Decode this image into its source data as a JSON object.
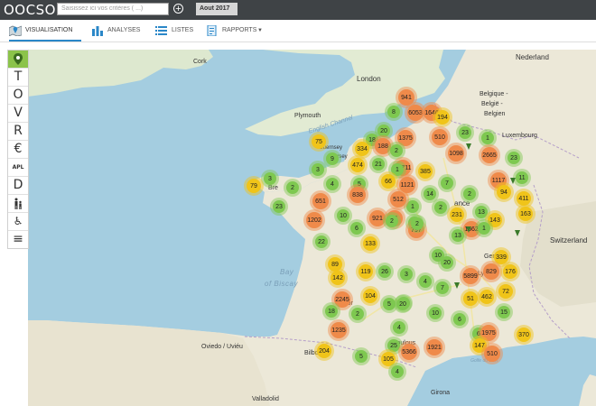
{
  "app": {
    "logo": "OOCSO"
  },
  "search": {
    "placeholder": "Saisissez ici vos critères ( ...)"
  },
  "date_chip": "Aout 2017",
  "nav": {
    "tabs": [
      {
        "label": "VISUALISATION",
        "icon": "map-icon"
      },
      {
        "label": "ANALYSES",
        "icon": "bar-chart-icon"
      },
      {
        "label": "LISTES",
        "icon": "list-icon"
      },
      {
        "label": "RAPPORTS",
        "icon": "report-icon"
      }
    ]
  },
  "toolbar": {
    "items": [
      "T",
      "O",
      "V",
      "R",
      "€",
      "APL",
      "D",
      "",
      "",
      ""
    ]
  },
  "map": {
    "labels": [
      {
        "name": "cork",
        "text": "Cork"
      },
      {
        "name": "london",
        "text": "London"
      },
      {
        "name": "plymouth",
        "text": "Plymouth"
      },
      {
        "name": "english-channel",
        "text": "English Channel"
      },
      {
        "name": "guernsey",
        "text": "Guernsey"
      },
      {
        "name": "jersey",
        "text": "Jersey"
      },
      {
        "name": "nederland",
        "text": "Nederland"
      },
      {
        "name": "belgique",
        "text": "Belgique -"
      },
      {
        "name": "belgie",
        "text": "België -"
      },
      {
        "name": "belgien",
        "text": "Belgien"
      },
      {
        "name": "luxembourg",
        "text": "Luxembourg"
      },
      {
        "name": "ance",
        "text": "ance"
      },
      {
        "name": "switzerland",
        "text": "Switzerland"
      },
      {
        "name": "bay",
        "text": "Bay"
      },
      {
        "name": "of-biscay",
        "text": "of Biscay"
      },
      {
        "name": "bordeaux",
        "text": "Bor"
      },
      {
        "name": "geneve",
        "text": "Genève"
      },
      {
        "name": "lyon",
        "text": "Lyo"
      },
      {
        "name": "toulouse",
        "text": "Toulous"
      },
      {
        "name": "oviedo",
        "text": "Oviedo / Uviéu"
      },
      {
        "name": "bilbo",
        "text": "Bilbo"
      },
      {
        "name": "valladolid",
        "text": "Valladolid"
      },
      {
        "name": "girona",
        "text": "Girona"
      },
      {
        "name": "golfe-du-lion",
        "text": "Golfe du Lion"
      },
      {
        "name": "brest",
        "text": "Bre"
      }
    ],
    "clusters": [
      {
        "v": "941",
        "c": "o"
      },
      {
        "v": "8",
        "c": "g"
      },
      {
        "v": "6053",
        "c": "o"
      },
      {
        "v": "1646",
        "c": "o"
      },
      {
        "v": "194",
        "c": "y"
      },
      {
        "v": "510",
        "c": "o"
      },
      {
        "v": "23",
        "c": "g"
      },
      {
        "v": "1",
        "c": "g"
      },
      {
        "v": "18",
        "c": "g"
      },
      {
        "v": "20",
        "c": "g"
      },
      {
        "v": "1375",
        "c": "o"
      },
      {
        "v": "188",
        "c": "o"
      },
      {
        "v": "334",
        "c": "y"
      },
      {
        "v": "75",
        "c": "y"
      },
      {
        "v": "2",
        "c": "g"
      },
      {
        "v": "1098",
        "c": "o"
      },
      {
        "v": "2665",
        "c": "o"
      },
      {
        "v": "23",
        "c": "g"
      },
      {
        "v": "3",
        "c": "g"
      },
      {
        "v": "9",
        "c": "g"
      },
      {
        "v": "474",
        "c": "y"
      },
      {
        "v": "21",
        "c": "g"
      },
      {
        "v": "37711",
        "c": "o"
      },
      {
        "v": "385",
        "c": "y"
      },
      {
        "v": "1",
        "c": "g"
      },
      {
        "v": "11",
        "c": "g"
      },
      {
        "v": "1117",
        "c": "o"
      },
      {
        "v": "5",
        "c": "g"
      },
      {
        "v": "3",
        "c": "g"
      },
      {
        "v": "79",
        "c": "y"
      },
      {
        "v": "2",
        "c": "g"
      },
      {
        "v": "4",
        "c": "g"
      },
      {
        "v": "66",
        "c": "y"
      },
      {
        "v": "1121",
        "c": "o"
      },
      {
        "v": "14",
        "c": "g"
      },
      {
        "v": "7",
        "c": "g"
      },
      {
        "v": "2",
        "c": "g"
      },
      {
        "v": "1",
        "c": "g"
      },
      {
        "v": "94",
        "c": "y"
      },
      {
        "v": "838",
        "c": "o"
      },
      {
        "v": "512",
        "c": "o"
      },
      {
        "v": "411",
        "c": "y"
      },
      {
        "v": "23",
        "c": "g"
      },
      {
        "v": "651",
        "c": "o"
      },
      {
        "v": "2",
        "c": "g"
      },
      {
        "v": "1202",
        "c": "o"
      },
      {
        "v": "10",
        "c": "g"
      },
      {
        "v": "921",
        "c": "o"
      },
      {
        "v": "21",
        "c": "o"
      },
      {
        "v": "3",
        "c": "g"
      },
      {
        "v": "231",
        "c": "y"
      },
      {
        "v": "13",
        "c": "g"
      },
      {
        "v": "143",
        "c": "y"
      },
      {
        "v": "163",
        "c": "y"
      },
      {
        "v": "6",
        "c": "g"
      },
      {
        "v": "797",
        "c": "o"
      },
      {
        "v": "2",
        "c": "g"
      },
      {
        "v": "1662",
        "c": "o"
      },
      {
        "v": "1",
        "c": "g"
      },
      {
        "v": "22",
        "c": "g"
      },
      {
        "v": "133",
        "c": "y"
      },
      {
        "v": "2",
        "c": "g"
      },
      {
        "v": "13",
        "c": "g"
      },
      {
        "v": "10",
        "c": "g"
      },
      {
        "v": "339",
        "c": "y"
      },
      {
        "v": "89",
        "c": "y"
      },
      {
        "v": "20",
        "c": "g"
      },
      {
        "v": "829",
        "c": "o"
      },
      {
        "v": "176",
        "c": "y"
      },
      {
        "v": "142",
        "c": "y"
      },
      {
        "v": "119",
        "c": "y"
      },
      {
        "v": "26",
        "c": "g"
      },
      {
        "v": "3",
        "c": "g"
      },
      {
        "v": "5899",
        "c": "o"
      },
      {
        "v": "4",
        "c": "g"
      },
      {
        "v": "7",
        "c": "g"
      },
      {
        "v": "72",
        "c": "y"
      },
      {
        "v": "2245",
        "c": "o"
      },
      {
        "v": "104",
        "c": "y"
      },
      {
        "v": "5",
        "c": "g"
      },
      {
        "v": "6",
        "c": "g"
      },
      {
        "v": "51",
        "c": "y"
      },
      {
        "v": "462",
        "c": "y"
      },
      {
        "v": "20",
        "c": "g"
      },
      {
        "v": "18",
        "c": "g"
      },
      {
        "v": "2",
        "c": "g"
      },
      {
        "v": "15",
        "c": "g"
      },
      {
        "v": "10",
        "c": "g"
      },
      {
        "v": "6",
        "c": "g"
      },
      {
        "v": "4",
        "c": "g"
      },
      {
        "v": "1235",
        "c": "o"
      },
      {
        "v": "6",
        "c": "g"
      },
      {
        "v": "1975",
        "c": "o"
      },
      {
        "v": "370",
        "c": "y"
      },
      {
        "v": "1921",
        "c": "o"
      },
      {
        "v": "25",
        "c": "g"
      },
      {
        "v": "5366",
        "c": "o"
      },
      {
        "v": "147",
        "c": "y"
      },
      {
        "v": "510",
        "c": "o"
      },
      {
        "v": "204",
        "c": "y"
      },
      {
        "v": "5",
        "c": "g"
      },
      {
        "v": "105",
        "c": "y"
      },
      {
        "v": "4",
        "c": "g"
      }
    ]
  }
}
